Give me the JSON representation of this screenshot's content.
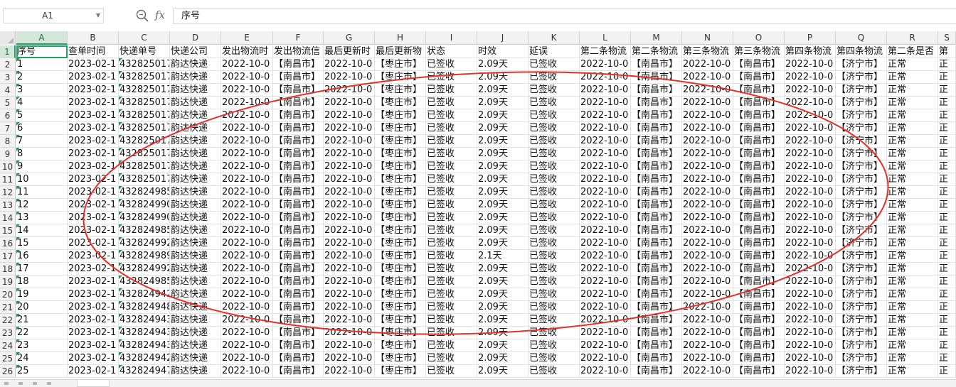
{
  "formula_bar": {
    "name_box": "A1",
    "zoom_icon": "zoom-icon",
    "fx_label": "fx",
    "formula_value": "序号"
  },
  "columns": [
    "A",
    "B",
    "C",
    "D",
    "E",
    "F",
    "G",
    "H",
    "I",
    "J",
    "K",
    "L",
    "M",
    "N",
    "O",
    "P",
    "Q",
    "R",
    "S"
  ],
  "active_column": "A",
  "header_row": [
    "序号",
    "查单时间",
    "快递单号",
    "快递公司",
    "发出物流时",
    "发出物流信",
    "最后更新时",
    "最后更新物",
    "状态",
    "时效",
    "延误",
    "第二条物流",
    "第二条物流",
    "第三条物流",
    "第三条物流",
    "第四条物流",
    "第四条物流",
    "第二条是否",
    "第"
  ],
  "rows": [
    [
      "1",
      "2023-02-1",
      "432825017",
      "韵达快递",
      "2022-10-0",
      "【南昌市】",
      "2022-10-0",
      "【枣庄市】",
      "已签收",
      "2.09天",
      "已签收",
      "2022-10-0",
      "【南昌市】",
      "2022-10-0",
      "【南昌市】",
      "2022-10-0",
      "【济宁市】",
      "正常",
      "正"
    ],
    [
      "2",
      "2023-02-1",
      "432825017",
      "韵达快递",
      "2022-10-0",
      "【南昌市】",
      "2022-10-0",
      "【枣庄市】",
      "已签收",
      "2.09天",
      "已签收",
      "2022-10-0",
      "【南昌市】",
      "2022-10-0",
      "【南昌市】",
      "2022-10-0",
      "【济宁市】",
      "正常",
      "正"
    ],
    [
      "3",
      "2023-02-1",
      "432825017",
      "韵达快递",
      "2022-10-0",
      "【南昌市】",
      "2022-10-0",
      "【枣庄市】",
      "已签收",
      "2.09天",
      "已签收",
      "2022-10-0",
      "【南昌市】",
      "2022-10-0",
      "【南昌市】",
      "2022-10-0",
      "【济宁市】",
      "正常",
      "正"
    ],
    [
      "4",
      "2023-02-1",
      "432825017",
      "韵达快递",
      "2022-10-0",
      "【南昌市】",
      "2022-10-0",
      "【枣庄市】",
      "已签收",
      "2.09天",
      "已签收",
      "2022-10-0",
      "【南昌市】",
      "2022-10-0",
      "【南昌市】",
      "2022-10-0",
      "【济宁市】",
      "正常",
      "正"
    ],
    [
      "5",
      "2023-02-1",
      "432825017",
      "韵达快递",
      "2022-10-0",
      "【南昌市】",
      "2022-10-0",
      "【枣庄市】",
      "已签收",
      "2.09天",
      "已签收",
      "2022-10-0",
      "【南昌市】",
      "2022-10-0",
      "【南昌市】",
      "2022-10-0",
      "【济宁市】",
      "正常",
      "正"
    ],
    [
      "6",
      "2023-02-1",
      "432825017",
      "韵达快递",
      "2022-10-0",
      "【南昌市】",
      "2022-10-0",
      "【枣庄市】",
      "已签收",
      "2.09天",
      "已签收",
      "2022-10-0",
      "【南昌市】",
      "2022-10-0",
      "【南昌市】",
      "2022-10-0",
      "【济宁市】",
      "正常",
      "正"
    ],
    [
      "7",
      "2023-02-1",
      "432825017",
      "韵达快递",
      "2022-10-0",
      "【南昌市】",
      "2022-10-0",
      "【枣庄市】",
      "已签收",
      "2.09天",
      "已签收",
      "2022-10-0",
      "【南昌市】",
      "2022-10-0",
      "【南昌市】",
      "2022-10-0",
      "【济宁市】",
      "正常",
      "正"
    ],
    [
      "8",
      "2023-02-1",
      "432825017",
      "韵达快递",
      "2022-10-0",
      "【南昌市】",
      "2022-10-0",
      "【枣庄市】",
      "已签收",
      "2.09天",
      "已签收",
      "2022-10-0",
      "【南昌市】",
      "2022-10-0",
      "【南昌市】",
      "2022-10-0",
      "【济宁市】",
      "正常",
      "正"
    ],
    [
      "9",
      "2023-02-1",
      "432825017",
      "韵达快递",
      "2022-10-0",
      "【南昌市】",
      "2022-10-0",
      "【枣庄市】",
      "已签收",
      "2.09天",
      "已签收",
      "2022-10-0",
      "【南昌市】",
      "2022-10-0",
      "【南昌市】",
      "2022-10-0",
      "【济宁市】",
      "正常",
      "正"
    ],
    [
      "10",
      "2023-02-1",
      "432825017",
      "韵达快递",
      "2022-10-0",
      "【南昌市】",
      "2022-10-0",
      "【枣庄市】",
      "已签收",
      "2.09天",
      "已签收",
      "2022-10-0",
      "【南昌市】",
      "2022-10-0",
      "【南昌市】",
      "2022-10-0",
      "【济宁市】",
      "正常",
      "正"
    ],
    [
      "11",
      "2023-02-1",
      "432824985",
      "韵达快递",
      "2022-10-0",
      "【南昌市】",
      "2022-10-0",
      "【枣庄市】",
      "已签收",
      "2.09天",
      "已签收",
      "2022-10-0",
      "【南昌市】",
      "2022-10-0",
      "【南昌市】",
      "2022-10-0",
      "【济宁市】",
      "正常",
      "正"
    ],
    [
      "12",
      "2023-02-1",
      "432824990",
      "韵达快递",
      "2022-10-0",
      "【南昌市】",
      "2022-10-0",
      "【枣庄市】",
      "已签收",
      "2.09天",
      "已签收",
      "2022-10-0",
      "【南昌市】",
      "2022-10-0",
      "【南昌市】",
      "2022-10-0",
      "【济宁市】",
      "正常",
      "正"
    ],
    [
      "13",
      "2023-02-1",
      "432824990",
      "韵达快递",
      "2022-10-0",
      "【南昌市】",
      "2022-10-0",
      "【枣庄市】",
      "已签收",
      "2.09天",
      "已签收",
      "2022-10-0",
      "【南昌市】",
      "2022-10-0",
      "【南昌市】",
      "2022-10-0",
      "【济宁市】",
      "正常",
      "正"
    ],
    [
      "14",
      "2023-02-1",
      "432824985",
      "韵达快递",
      "2022-10-0",
      "【南昌市】",
      "2022-10-0",
      "【枣庄市】",
      "已签收",
      "2.09天",
      "已签收",
      "2022-10-0",
      "【南昌市】",
      "2022-10-0",
      "【南昌市】",
      "2022-10-0",
      "【济宁市】",
      "正常",
      "正"
    ],
    [
      "15",
      "2023-02-1",
      "432824992",
      "韵达快递",
      "2022-10-0",
      "【南昌市】",
      "2022-10-0",
      "【枣庄市】",
      "已签收",
      "2.09天",
      "已签收",
      "2022-10-0",
      "【南昌市】",
      "2022-10-0",
      "【南昌市】",
      "2022-10-0",
      "【济宁市】",
      "正常",
      "正"
    ],
    [
      "16",
      "2023-02-1",
      "432824989",
      "韵达快递",
      "2022-10-0",
      "【南昌市】",
      "2022-10-0",
      "【枣庄市】",
      "已签收",
      "2.1天",
      "已签收",
      "2022-10-0",
      "【南昌市】",
      "2022-10-0",
      "【南昌市】",
      "2022-10-0",
      "【济宁市】",
      "正常",
      "正"
    ],
    [
      "17",
      "2023-02-1",
      "432824992",
      "韵达快递",
      "2022-10-0",
      "【南昌市】",
      "2022-10-0",
      "【枣庄市】",
      "已签收",
      "2.09天",
      "已签收",
      "2022-10-0",
      "【南昌市】",
      "2022-10-0",
      "【南昌市】",
      "2022-10-0",
      "【济宁市】",
      "正常",
      "正"
    ],
    [
      "18",
      "2023-02-1",
      "432824985",
      "韵达快递",
      "2022-10-0",
      "【南昌市】",
      "2022-10-0",
      "【枣庄市】",
      "已签收",
      "2.09天",
      "已签收",
      "2022-10-0",
      "【南昌市】",
      "2022-10-0",
      "【南昌市】",
      "2022-10-0",
      "【济宁市】",
      "正常",
      "正"
    ],
    [
      "19",
      "2023-02-1",
      "432824942",
      "韵达快递",
      "2022-10-0",
      "【南昌市】",
      "2022-10-0",
      "【枣庄市】",
      "已签收",
      "2.09天",
      "已签收",
      "2022-10-0",
      "【南昌市】",
      "2022-10-0",
      "【南昌市】",
      "2022-10-0",
      "【济宁市】",
      "正常",
      "正"
    ],
    [
      "20",
      "2023-02-1",
      "432824948",
      "韵达快递",
      "2022-10-0",
      "【南昌市】",
      "2022-10-0",
      "【枣庄市】",
      "已签收",
      "2.09天",
      "已签收",
      "2022-10-0",
      "【南昌市】",
      "2022-10-0",
      "【南昌市】",
      "2022-10-0",
      "【济宁市】",
      "正常",
      "正"
    ],
    [
      "21",
      "2023-02-1",
      "432824943",
      "韵达快递",
      "2022-10-0",
      "【南昌市】",
      "2022-10-0",
      "【枣庄市】",
      "已签收",
      "2.09天",
      "已签收",
      "2022-10-0",
      "【南昌市】",
      "2022-10-0",
      "【南昌市】",
      "2022-10-0",
      "【济宁市】",
      "正常",
      "正"
    ],
    [
      "22",
      "2023-02-1",
      "432824943",
      "韵达快递",
      "2022-10-0",
      "【南昌市】",
      "2022-10-0",
      "【枣庄市】",
      "已签收",
      "2.09天",
      "已签收",
      "2022-10-0",
      "【南昌市】",
      "2022-10-0",
      "【南昌市】",
      "2022-10-0",
      "【济宁市】",
      "正常",
      "正"
    ],
    [
      "23",
      "2023-02-1",
      "432824943",
      "韵达快递",
      "2022-10-0",
      "【南昌市】",
      "2022-10-0",
      "【枣庄市】",
      "已签收",
      "2.09天",
      "已签收",
      "2022-10-0",
      "【南昌市】",
      "2022-10-0",
      "【南昌市】",
      "2022-10-0",
      "【济宁市】",
      "正常",
      "正"
    ],
    [
      "24",
      "2023-02-1",
      "432824942",
      "韵达快递",
      "2022-10-0",
      "【南昌市】",
      "2022-10-0",
      "【枣庄市】",
      "已签收",
      "2.09天",
      "已签收",
      "2022-10-0",
      "【南昌市】",
      "2022-10-0",
      "【南昌市】",
      "2022-10-0",
      "【济宁市】",
      "正常",
      "正"
    ],
    [
      "25",
      "2023-02-1",
      "432824947",
      "韵达快递",
      "2022-10-0",
      "【南昌市】",
      "2022-10-0",
      "【枣庄市】",
      "已签收",
      "2.09天",
      "已签收",
      "2022-10-0",
      "【南昌市】",
      "2022-10-0",
      "【南昌市】",
      "2022-10-0",
      "【济宁市】",
      "正常",
      "正"
    ]
  ],
  "annotation_color": "#e0312e",
  "selection_color": "#21a366"
}
